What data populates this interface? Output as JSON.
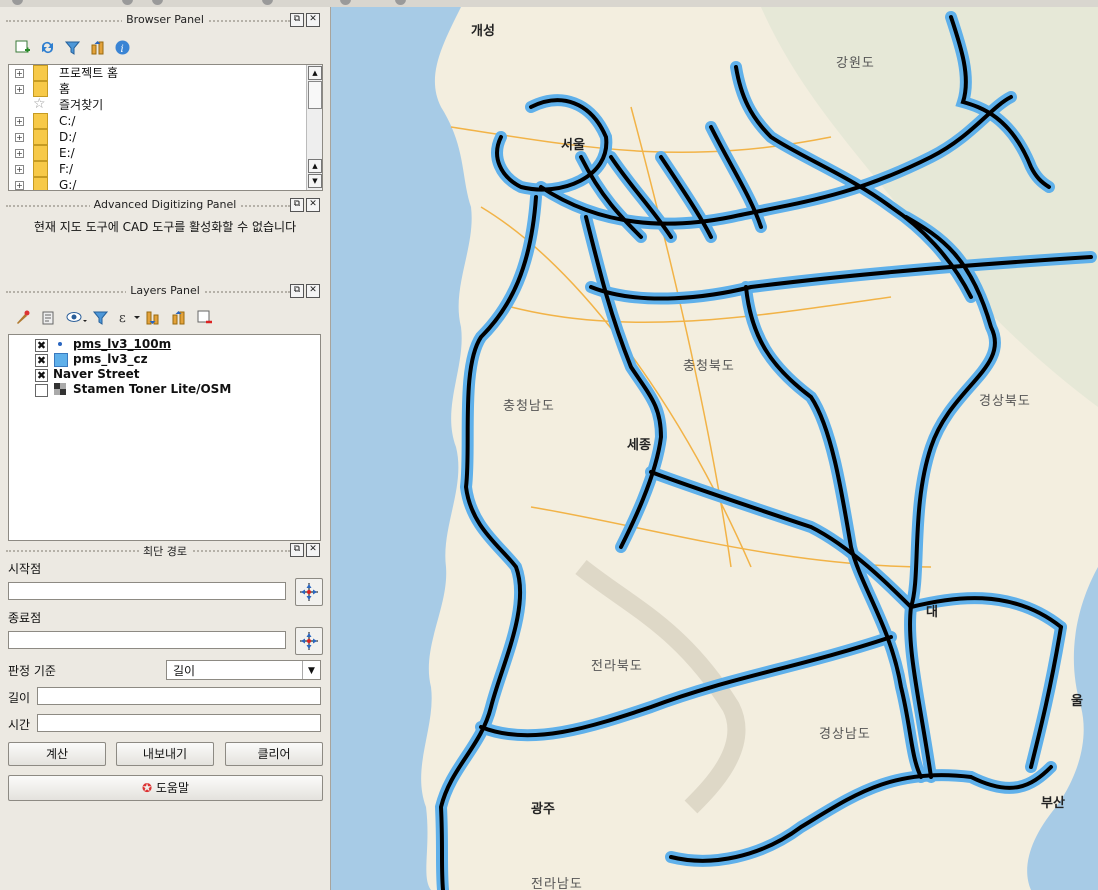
{
  "browser_panel": {
    "title": "Browser Panel",
    "items": [
      {
        "label": "프로젝트 홈",
        "icon": "folder-icon"
      },
      {
        "label": "홈",
        "icon": "folder-icon"
      },
      {
        "label": "즐겨찾기",
        "icon": "star-icon"
      },
      {
        "label": "C:/",
        "icon": "folder-icon"
      },
      {
        "label": "D:/",
        "icon": "folder-icon"
      },
      {
        "label": "E:/",
        "icon": "folder-icon"
      },
      {
        "label": "F:/",
        "icon": "folder-icon"
      },
      {
        "label": "G:/",
        "icon": "folder-icon"
      }
    ]
  },
  "advanced_panel": {
    "title": "Advanced Digitizing Panel",
    "message": "현재 지도 도구에 CAD 도구를 활성화할 수 없습니다"
  },
  "layers_panel": {
    "title": "Layers Panel",
    "layers": [
      {
        "name": "pms_lv3_100m",
        "checked": true,
        "symbol": "point"
      },
      {
        "name": "pms_lv3_cz",
        "checked": true,
        "symbol": "fill"
      },
      {
        "name": "Naver Street",
        "checked": true,
        "symbol": "none"
      },
      {
        "name": "Stamen Toner Lite/OSM",
        "checked": false,
        "symbol": "raster"
      }
    ]
  },
  "route_panel": {
    "title": "최단 경로",
    "start_label": "시작점",
    "start_value": "",
    "end_label": "종료점",
    "end_value": "",
    "criterion_label": "판정 기준",
    "criterion_value": "길이",
    "length_label": "길이",
    "length_value": "",
    "time_label": "시간",
    "time_value": "",
    "calc_button": "계산",
    "export_button": "내보내기",
    "clear_button": "클리어",
    "help_button": "도움말"
  },
  "map": {
    "region_labels": [
      "강원도",
      "충청북도",
      "충청남도",
      "경상북도",
      "전라북도",
      "경상남도",
      "전라남도"
    ],
    "city_labels": [
      "개성",
      "서울",
      "세종",
      "대",
      "광주",
      "부산",
      "울"
    ],
    "colors": {
      "route_fill": "#5fb0ea",
      "route_outline": "#000000",
      "land": "#f3eedf",
      "sea": "#a7cbe6"
    }
  }
}
